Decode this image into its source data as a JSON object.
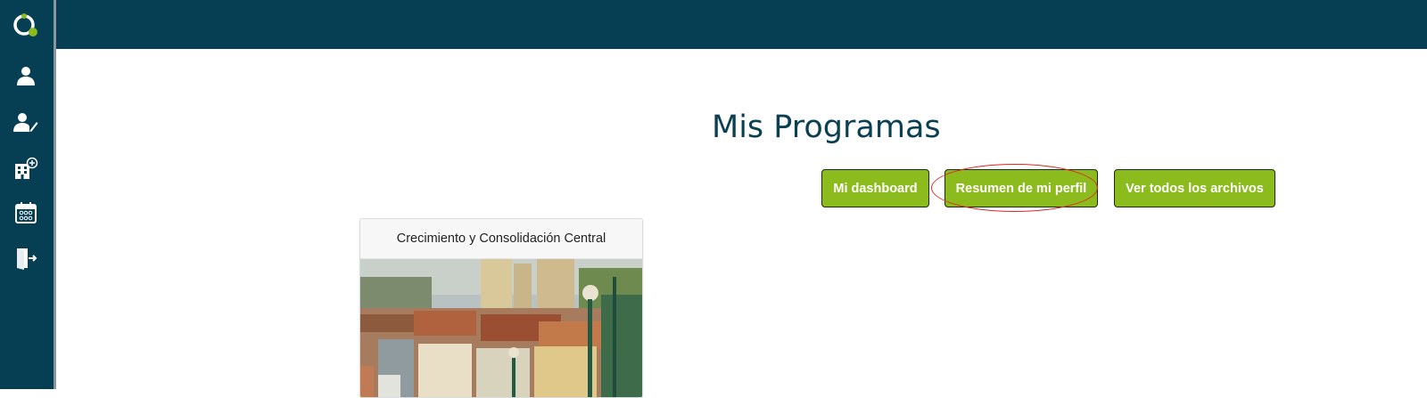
{
  "app": {
    "accent": "#8bbb1c",
    "nav_bg": "#063f53"
  },
  "sidebar": {
    "items": [
      {
        "icon": "user-icon"
      },
      {
        "icon": "user-edit-icon"
      },
      {
        "icon": "building-add-icon"
      },
      {
        "icon": "calendar-icon"
      },
      {
        "icon": "logout-door-icon"
      }
    ]
  },
  "main": {
    "title": "Mis Programas",
    "buttons": {
      "dashboard": "Mi dashboard",
      "profile_summary": "Resumen de mi perfil",
      "all_files": "Ver todos los archivos"
    },
    "programs": [
      {
        "title": "Crecimiento y Consolidación Central"
      }
    ]
  }
}
